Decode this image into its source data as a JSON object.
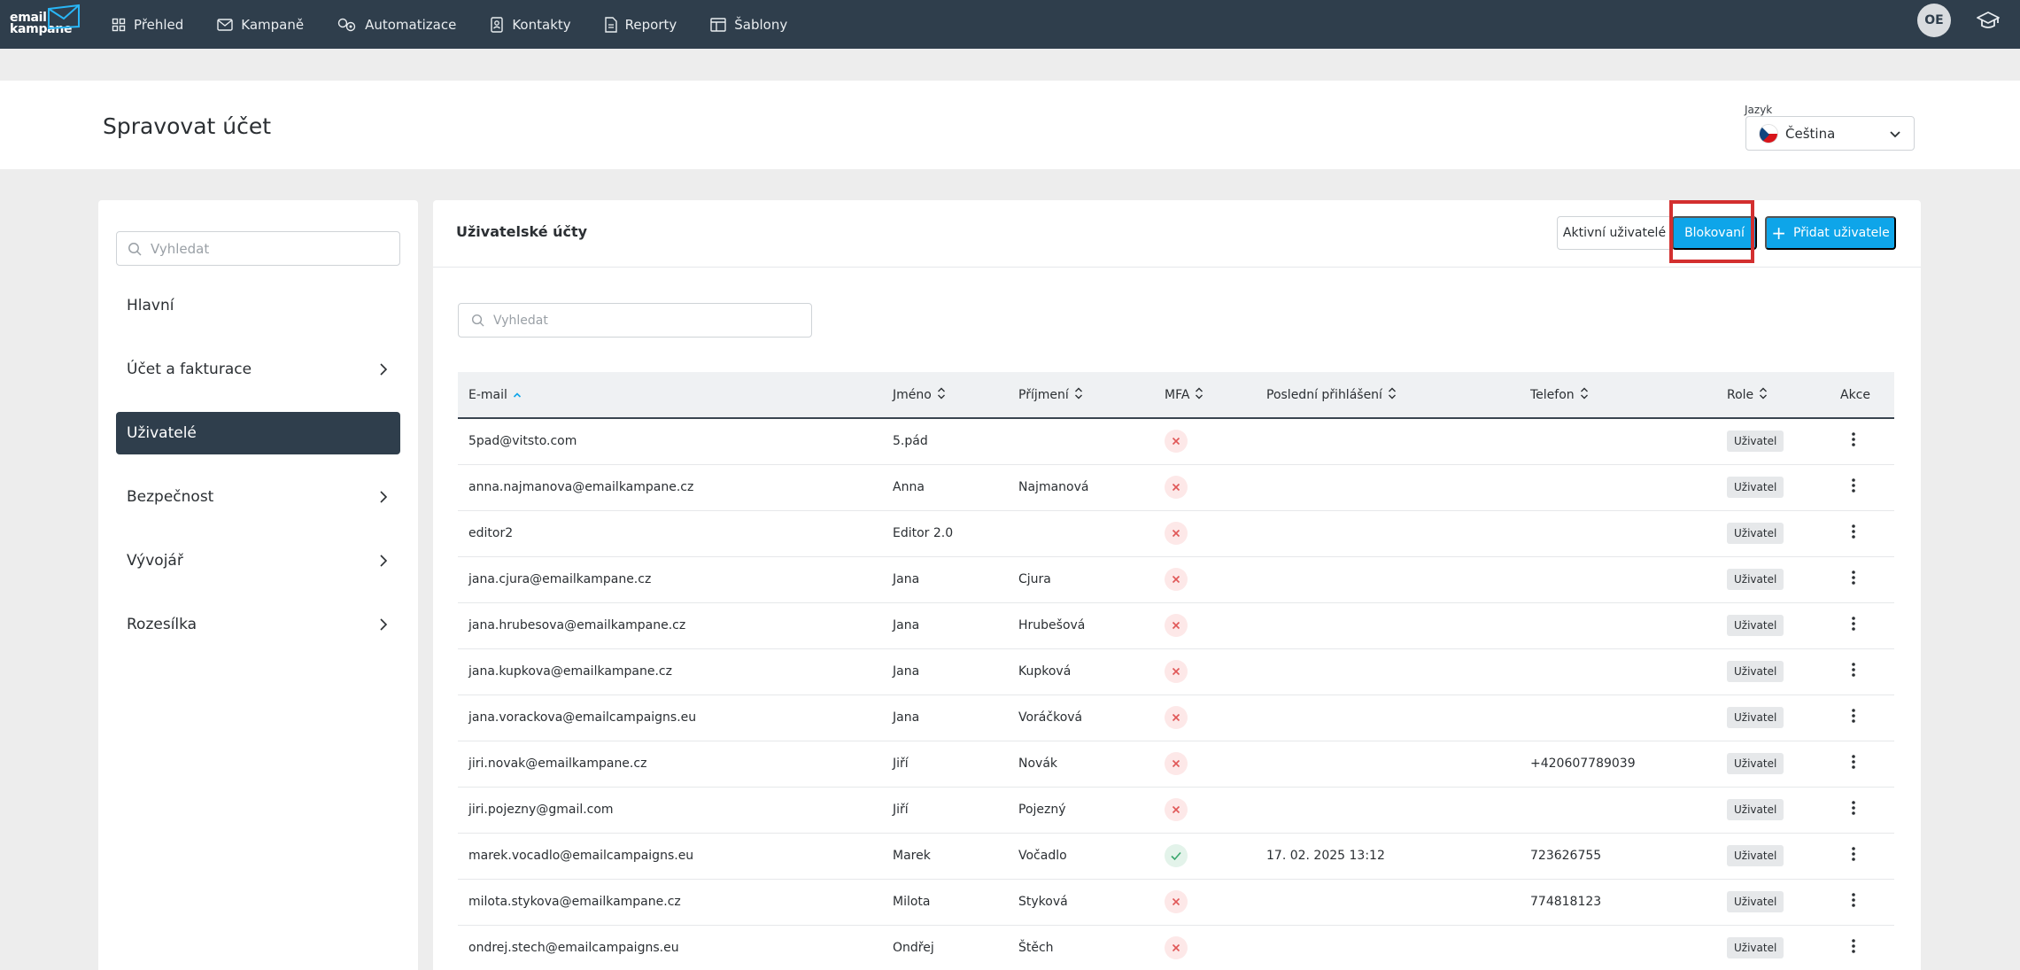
{
  "logo": {
    "line1": "email",
    "line2": "kampane"
  },
  "nav": [
    {
      "label": "Přehled",
      "icon": "grid-icon"
    },
    {
      "label": "Kampaně",
      "icon": "envelope-icon"
    },
    {
      "label": "Automatizace",
      "icon": "automation-icon"
    },
    {
      "label": "Kontakty",
      "icon": "contacts-icon"
    },
    {
      "label": "Reporty",
      "icon": "report-icon"
    },
    {
      "label": "Šablony",
      "icon": "template-icon"
    }
  ],
  "user": {
    "initials": "OE"
  },
  "page": {
    "title": "Spravovat účet"
  },
  "language": {
    "label": "Jazyk",
    "value": "Čeština"
  },
  "sidebar": {
    "search_placeholder": "Vyhledat",
    "items": [
      {
        "label": "Hlavní",
        "has_arrow": false,
        "active": false
      },
      {
        "label": "Účet a fakturace",
        "has_arrow": true,
        "active": false
      },
      {
        "label": "Uživatelé",
        "has_arrow": false,
        "active": true
      },
      {
        "label": "Bezpečnost",
        "has_arrow": true,
        "active": false
      },
      {
        "label": "Vývojář",
        "has_arrow": true,
        "active": false
      },
      {
        "label": "Rozesílka",
        "has_arrow": true,
        "active": false
      }
    ]
  },
  "main": {
    "title": "Uživatelské účty",
    "btn_active": "Aktivní uživatelé",
    "btn_blocked": "Blokovaní",
    "btn_add": "Přidat uživatele",
    "search_placeholder": "Vyhledat"
  },
  "table": {
    "headers": [
      "E-mail",
      "Jméno",
      "Příjmení",
      "MFA",
      "Poslední přihlášení",
      "Telefon",
      "Role",
      "Akce"
    ],
    "rows": [
      {
        "email": "5pad@vitsto.com",
        "first": "5.pád",
        "last": "",
        "mfa": false,
        "last_login": "",
        "phone": "",
        "role": "Uživatel"
      },
      {
        "email": "anna.najmanova@emailkampane.cz",
        "first": "Anna",
        "last": "Najmanová",
        "mfa": false,
        "last_login": "",
        "phone": "",
        "role": "Uživatel"
      },
      {
        "email": "editor2",
        "first": "Editor 2.0",
        "last": "",
        "mfa": false,
        "last_login": "",
        "phone": "",
        "role": "Uživatel"
      },
      {
        "email": "jana.cjura@emailkampane.cz",
        "first": "Jana",
        "last": "Cjura",
        "mfa": false,
        "last_login": "",
        "phone": "",
        "role": "Uživatel"
      },
      {
        "email": "jana.hrubesova@emailkampane.cz",
        "first": "Jana",
        "last": "Hrubešová",
        "mfa": false,
        "last_login": "",
        "phone": "",
        "role": "Uživatel"
      },
      {
        "email": "jana.kupkova@emailkampane.cz",
        "first": "Jana",
        "last": "Kupková",
        "mfa": false,
        "last_login": "",
        "phone": "",
        "role": "Uživatel"
      },
      {
        "email": "jana.vorackova@emailcampaigns.eu",
        "first": "Jana",
        "last": "Voráčková",
        "mfa": false,
        "last_login": "",
        "phone": "",
        "role": "Uživatel"
      },
      {
        "email": "jiri.novak@emailkampane.cz",
        "first": "Jiří",
        "last": "Novák",
        "mfa": false,
        "last_login": "",
        "phone": "+420607789039",
        "role": "Uživatel"
      },
      {
        "email": "jiri.pojezny@gmail.com",
        "first": "Jiří",
        "last": "Pojezný",
        "mfa": false,
        "last_login": "",
        "phone": "",
        "role": "Uživatel"
      },
      {
        "email": "marek.vocadlo@emailcampaigns.eu",
        "first": "Marek",
        "last": "Vočadlo",
        "mfa": true,
        "last_login": "17. 02. 2025 13:12",
        "phone": "723626755",
        "role": "Uživatel"
      },
      {
        "email": "milota.stykova@emailkampane.cz",
        "first": "Milota",
        "last": "Styková",
        "mfa": false,
        "last_login": "",
        "phone": "774818123",
        "role": "Uživatel"
      },
      {
        "email": "ondrej.stech@emailcampaigns.eu",
        "first": "Ondřej",
        "last": "Štěch",
        "mfa": false,
        "last_login": "",
        "phone": "",
        "role": "Uživatel"
      }
    ]
  },
  "colors": {
    "nav_bg": "#2f3e4c",
    "accent": "#0ea5e9",
    "highlight": "#d32f2f",
    "mfa_no": "#e05757",
    "mfa_yes": "#3aa76d"
  }
}
